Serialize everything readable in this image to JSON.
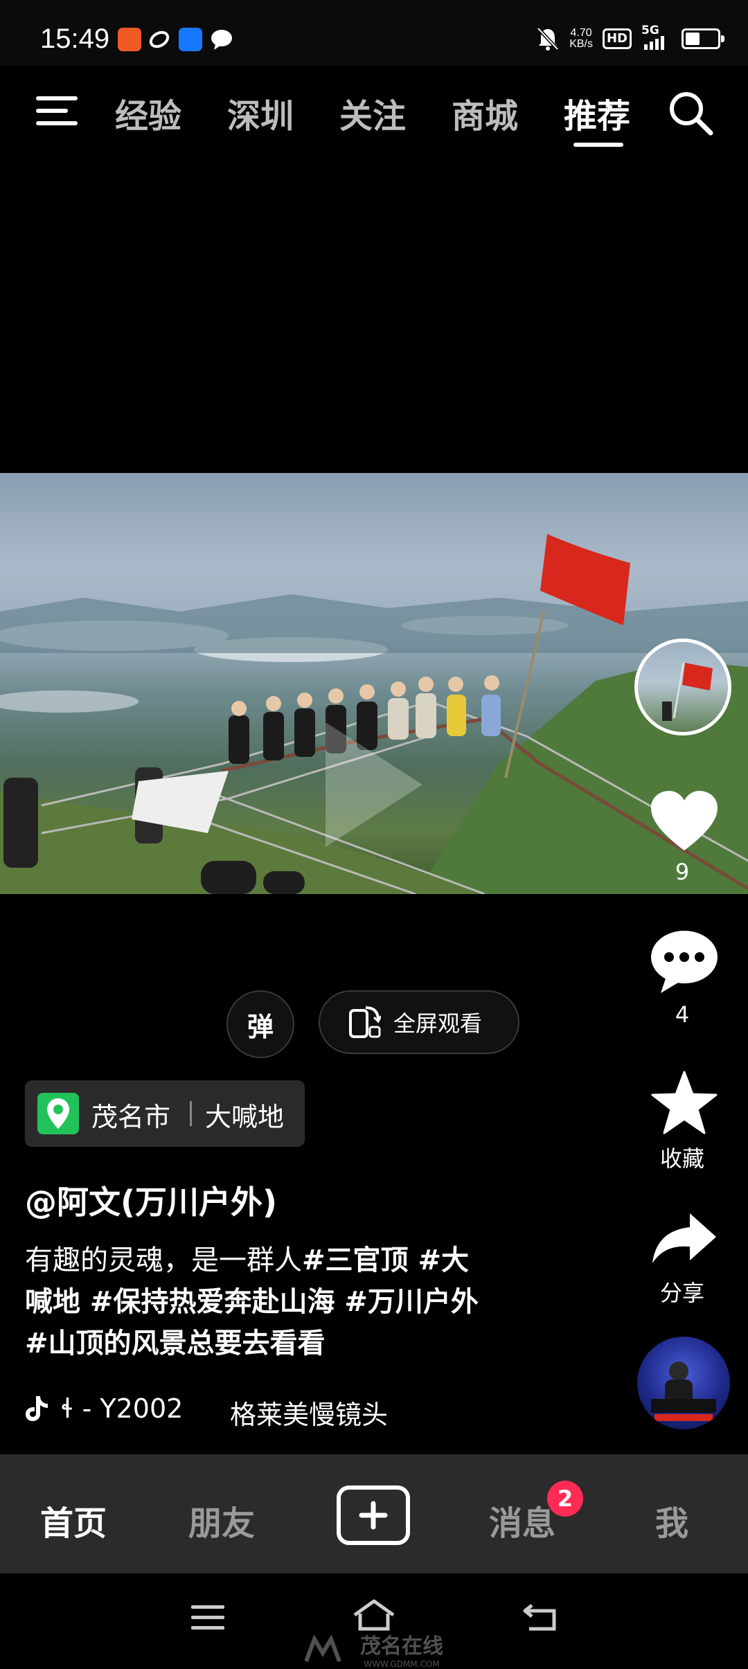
{
  "status_bar": {
    "time": "15:49",
    "net_speed": "4.70",
    "net_unit": "KB/s",
    "hd": "HD",
    "signal": "5G",
    "app_icons": [
      "kuaishou-icon",
      "douyin-icon",
      "alipay-icon",
      "message-icon"
    ]
  },
  "top_nav": {
    "tabs": [
      "经验",
      "深圳",
      "关注",
      "商城",
      "推荐"
    ],
    "active_tab": "推荐"
  },
  "right_rail": {
    "like_count": "9",
    "comment_count": "4",
    "favorite_label": "收藏",
    "share_label": "分享"
  },
  "video_controls": {
    "danmaku_label": "弹",
    "fullscreen_label": "全屏观看"
  },
  "location": {
    "city": "茂名市",
    "place": "大喊地"
  },
  "post": {
    "author": "@阿文(万川户外)",
    "caption_line1_plain": "有趣的灵魂，是一群人",
    "caption_line1_tags": "#三官顶 #大",
    "caption_line2": "喊地 #保持热爱奔赴山海 #万川户外",
    "caption_line3": "#山顶的风景总要去看看",
    "music_prefix": "ɬ - Y2002",
    "music_title": "格莱美慢镜头"
  },
  "bottom_nav": {
    "items": [
      "首页",
      "朋友",
      "消息",
      "我"
    ],
    "active": "首页",
    "message_badge": "2"
  },
  "watermark": {
    "brand": "茂名在线",
    "url": "WWW.GDMM.COM"
  },
  "colors": {
    "flag_red": "#d8281e",
    "badge_red": "#fe2c55",
    "location_green": "#22c25a"
  }
}
